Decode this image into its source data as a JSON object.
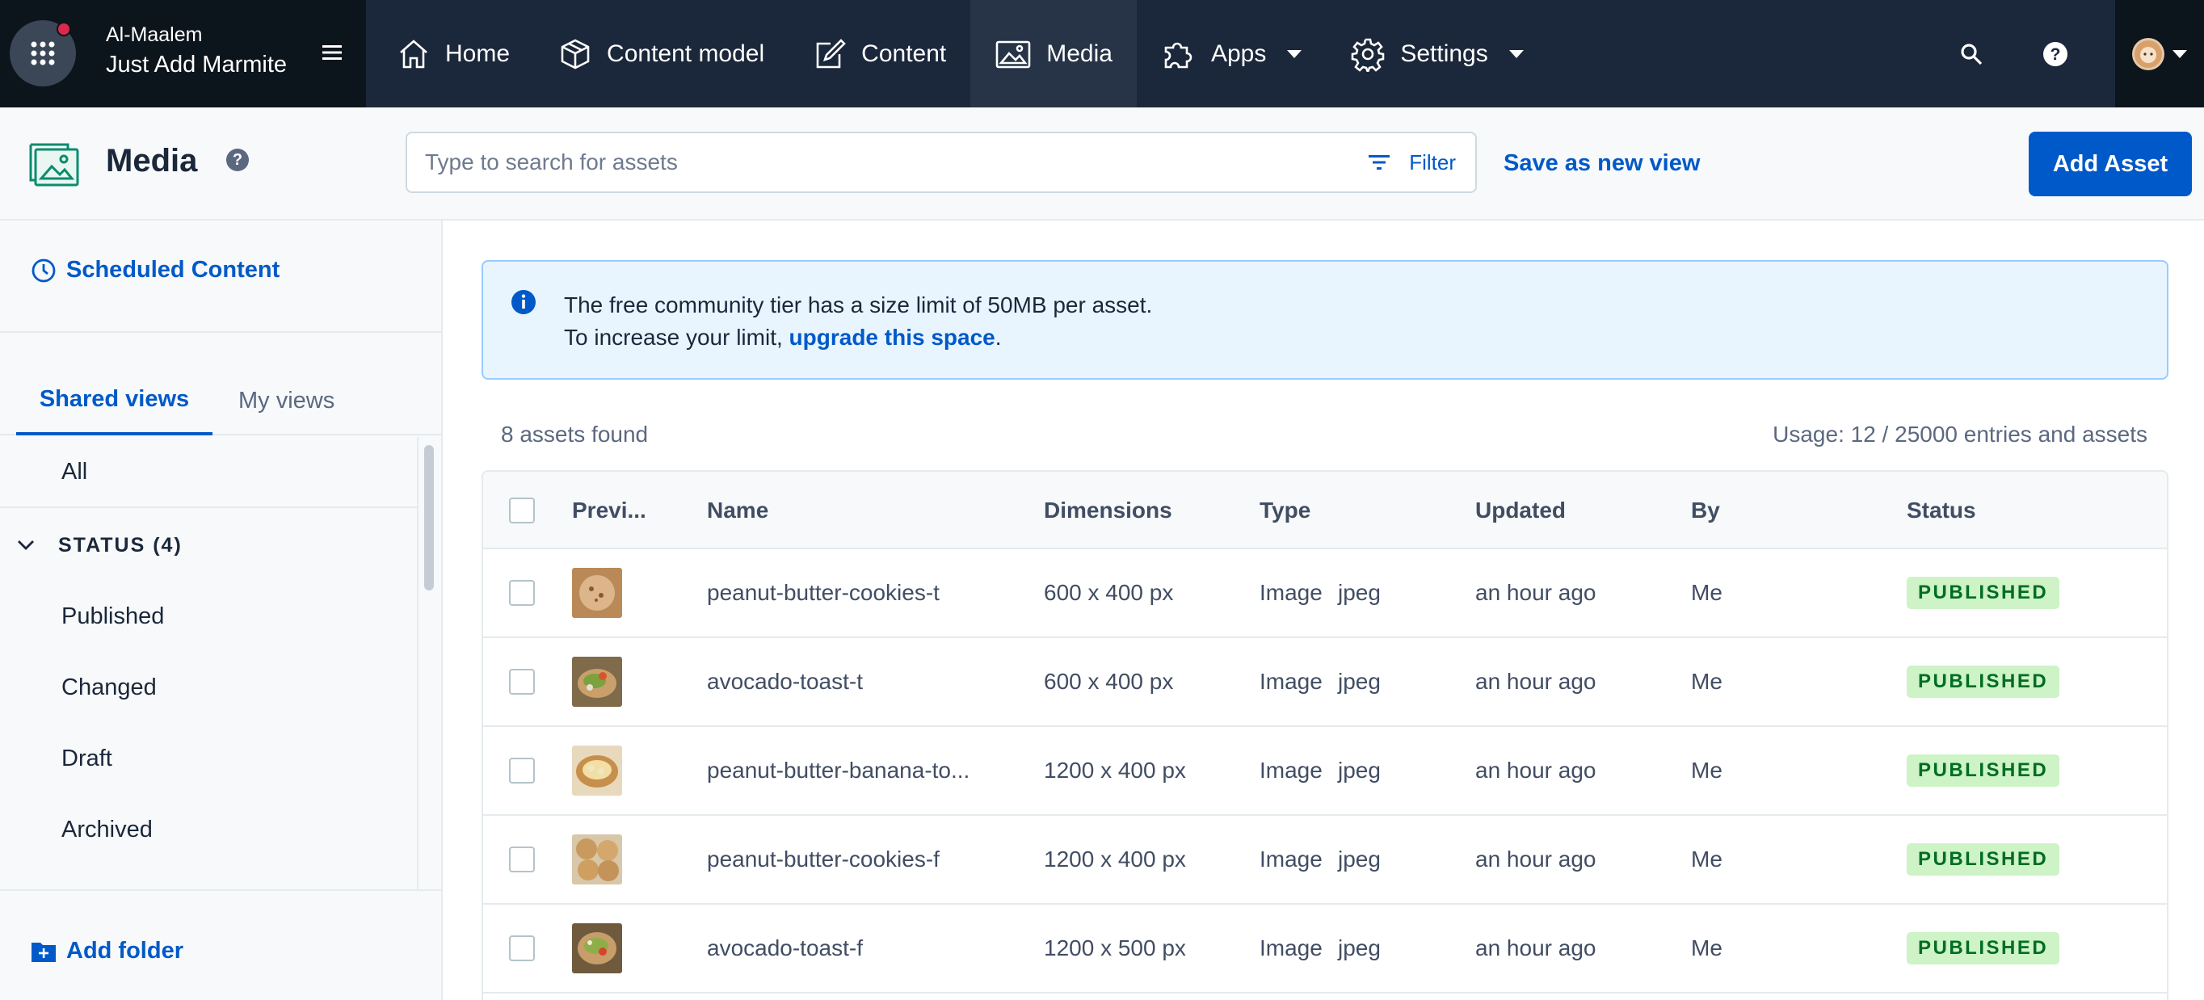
{
  "topbar": {
    "org_name": "Al-Maalem",
    "space_name": "Just Add Marmite",
    "nav": [
      {
        "label": "Home"
      },
      {
        "label": "Content model"
      },
      {
        "label": "Content"
      },
      {
        "label": "Media"
      },
      {
        "label": "Apps"
      },
      {
        "label": "Settings"
      }
    ],
    "active_nav": "Media"
  },
  "header": {
    "title": "Media",
    "search_placeholder": "Type to search for assets",
    "filter_label": "Filter",
    "save_view_label": "Save as new view",
    "add_asset_label": "Add Asset"
  },
  "sidebar": {
    "scheduled_label": "Scheduled Content",
    "tabs": [
      "Shared views",
      "My views"
    ],
    "all_label": "All",
    "status_group_label": "STATUS (4)",
    "status_items": [
      "Published",
      "Changed",
      "Draft",
      "Archived"
    ],
    "add_folder_label": "Add folder"
  },
  "notice": {
    "line1": "The free community tier has a size limit of 50MB per asset.",
    "line2_prefix": "To increase your limit, ",
    "line2_link": "upgrade this space",
    "line2_suffix": "."
  },
  "summary": {
    "found": "8 assets found",
    "usage": "Usage: 12 / 25000 entries and assets"
  },
  "table": {
    "headers": {
      "preview": "Previ...",
      "name": "Name",
      "dimensions": "Dimensions",
      "type": "Type",
      "updated": "Updated",
      "by": "By",
      "status": "Status"
    },
    "rows": [
      {
        "name": "peanut-butter-cookies-t",
        "dimensions": "600 x 400 px",
        "type": "Image",
        "format": "jpeg",
        "updated": "an hour ago",
        "by": "Me",
        "status": "PUBLISHED"
      },
      {
        "name": "avocado-toast-t",
        "dimensions": "600 x 400 px",
        "type": "Image",
        "format": "jpeg",
        "updated": "an hour ago",
        "by": "Me",
        "status": "PUBLISHED"
      },
      {
        "name": "peanut-butter-banana-to...",
        "dimensions": "1200 x 400 px",
        "type": "Image",
        "format": "jpeg",
        "updated": "an hour ago",
        "by": "Me",
        "status": "PUBLISHED"
      },
      {
        "name": "peanut-butter-cookies-f",
        "dimensions": "1200 x 400 px",
        "type": "Image",
        "format": "jpeg",
        "updated": "an hour ago",
        "by": "Me",
        "status": "PUBLISHED"
      },
      {
        "name": "avocado-toast-f",
        "dimensions": "1200 x 500 px",
        "type": "Image",
        "format": "jpeg",
        "updated": "an hour ago",
        "by": "Me",
        "status": "PUBLISHED"
      }
    ]
  },
  "colors": {
    "nav_bg": "#1b273a",
    "accent": "#0059c8",
    "published_bg": "#cdf3c6",
    "published_text": "#006d23"
  }
}
